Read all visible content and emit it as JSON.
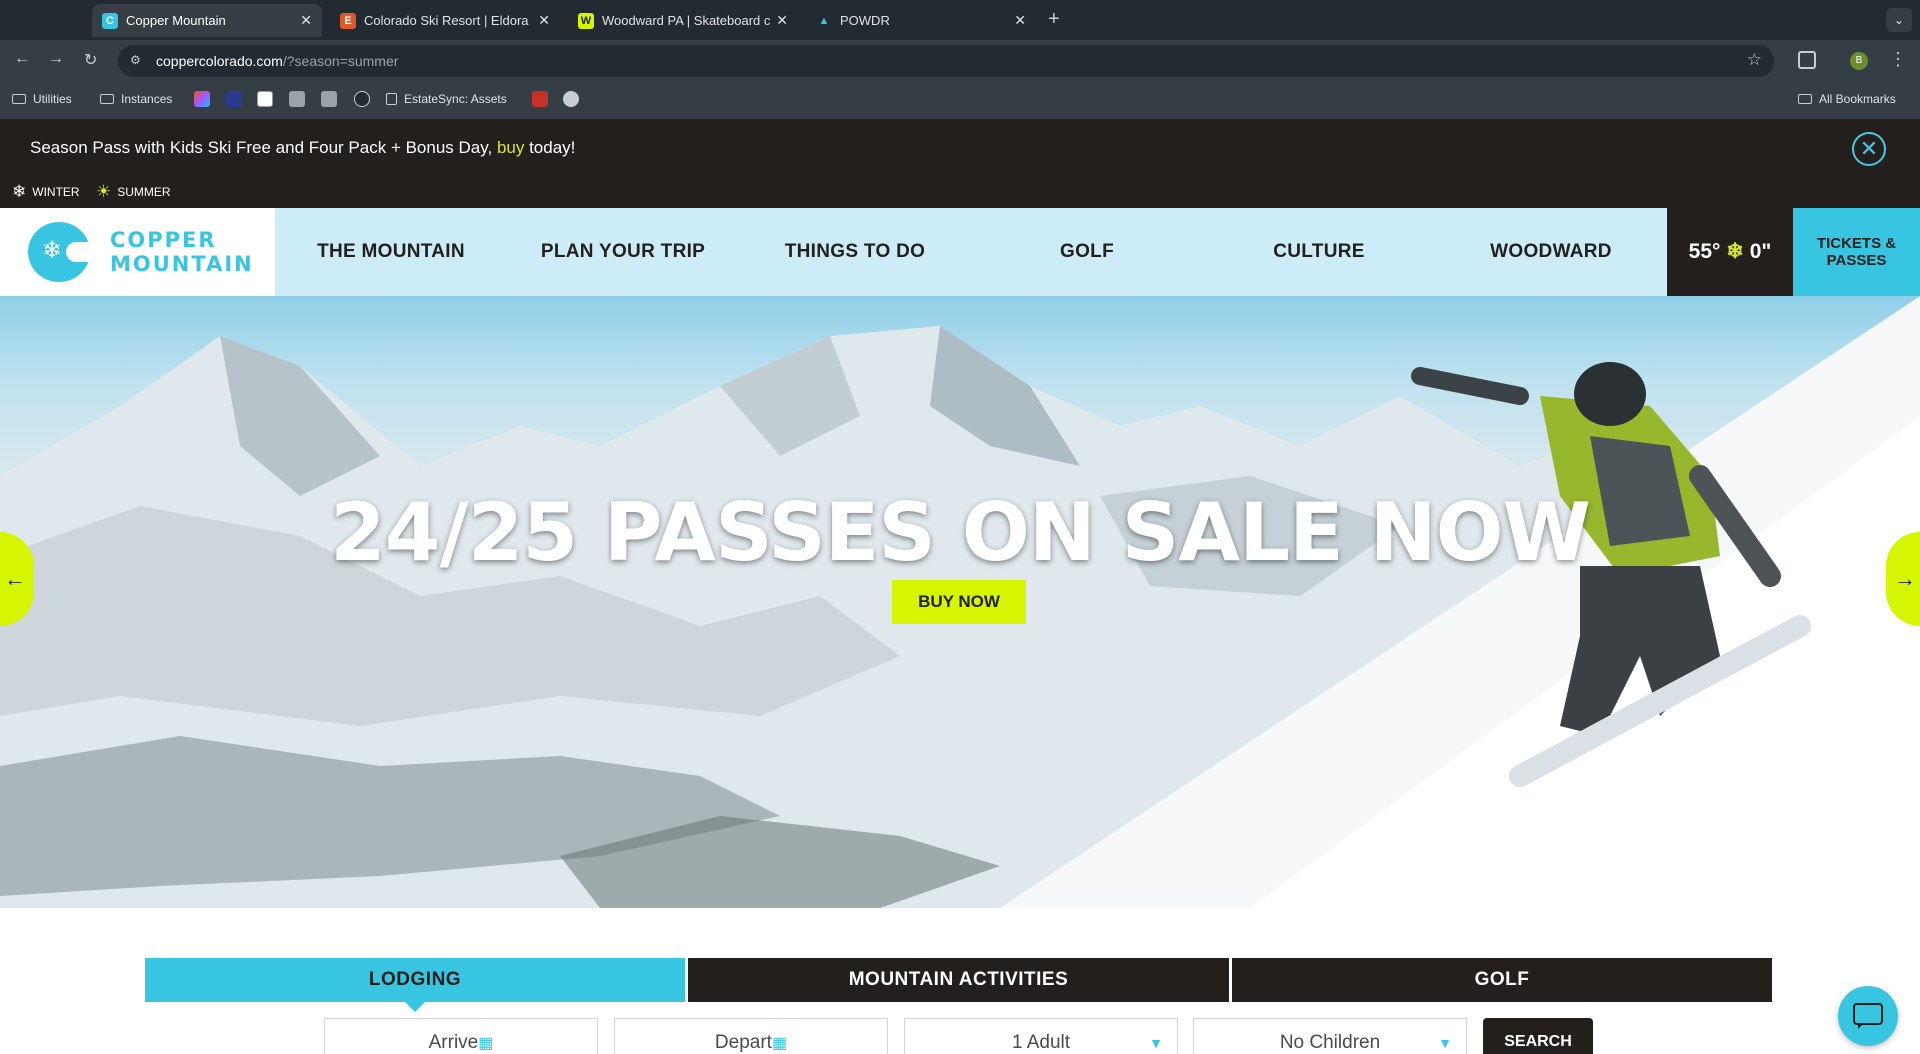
{
  "browser": {
    "tabs": [
      {
        "label": "Copper Mountain",
        "active": true
      },
      {
        "label": "Colorado Ski Resort | Eldora M"
      },
      {
        "label": "Woodward PA | Skateboard ca"
      },
      {
        "label": "POWDR"
      }
    ],
    "new_tab_label": "+",
    "url_host": "coppercolorado.com",
    "url_path": "/?season=summer",
    "profile_initial": "B",
    "bookmarks": [
      "Utilities",
      "Instances",
      "EstateSync: Assets"
    ],
    "all_bookmarks_label": "All Bookmarks"
  },
  "promo": {
    "text_before": "Season Pass with Kids Ski Free and Four Pack + Bonus Day, ",
    "link_text": "buy",
    "text_after": " today!",
    "close_glyph": "✕"
  },
  "season_toggle": {
    "winter_label": "WINTER",
    "summer_label": "SUMMER"
  },
  "site_nav": {
    "logo_line1": "COPPER",
    "logo_line2": "MOUNTAIN",
    "items": [
      "THE MOUNTAIN",
      "PLAN YOUR TRIP",
      "THINGS TO DO",
      "GOLF",
      "CULTURE",
      "WOODWARD"
    ],
    "weather_temp": "55°",
    "weather_snow": "0\"",
    "tickets_line1": "TICKETS &",
    "tickets_line2": "PASSES"
  },
  "hero": {
    "headline": "24/25 PASSES ON SALE NOW",
    "cta_label": "BUY NOW",
    "prev_arrow": "←",
    "next_arrow": "→"
  },
  "booking": {
    "tabs": [
      "LODGING",
      "MOUNTAIN ACTIVITIES",
      "GOLF"
    ],
    "active_tab": "LODGING",
    "arrive_label": "Arrive",
    "depart_label": "Depart",
    "adults_value": "1 Adult",
    "children_value": "No Children",
    "search_label": "SEARCH"
  },
  "colors": {
    "accent_cyan": "#38c5e2",
    "accent_lime": "#d6f500",
    "dark": "#231f1c",
    "nav_bg": "#ccecf8"
  },
  "icons": {
    "season_winter": "snowflake-icon",
    "season_summer": "sun-icon",
    "chat": "chat-bubble-icon"
  }
}
